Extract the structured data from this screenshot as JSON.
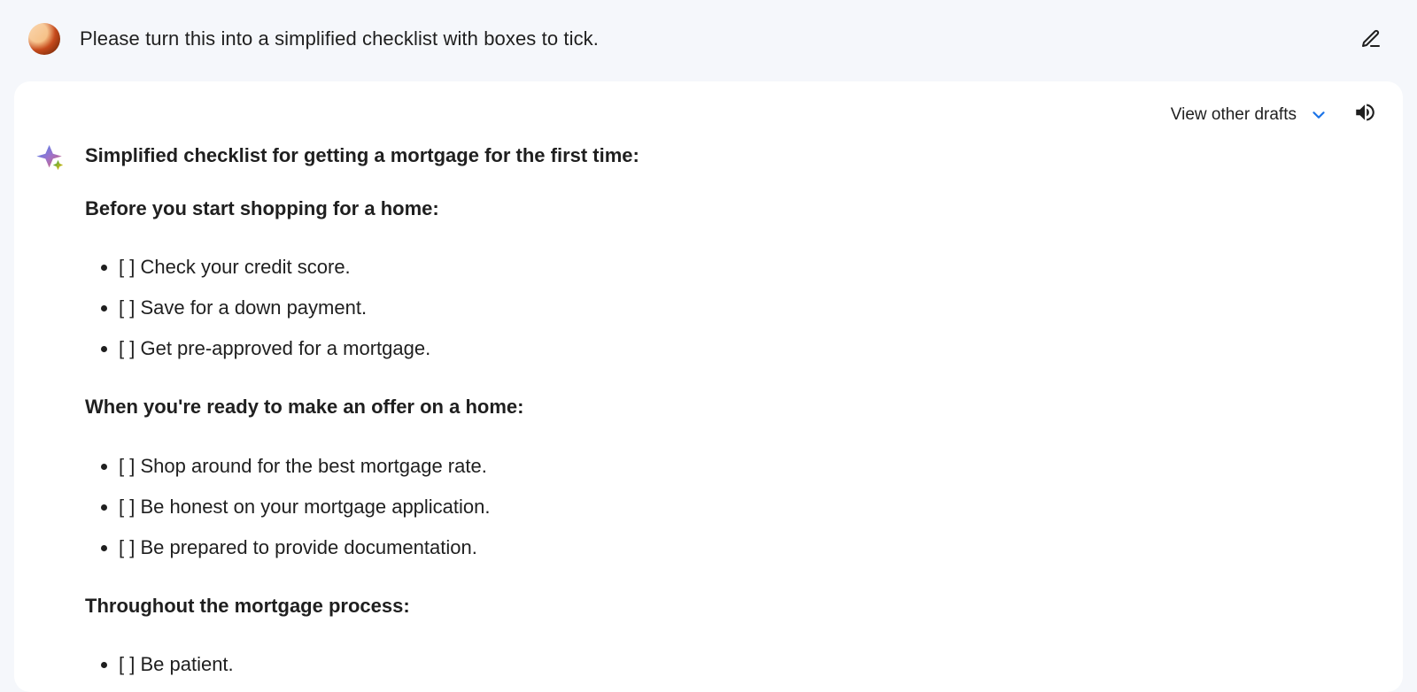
{
  "prompt": {
    "text": "Please turn this into a simplified checklist with boxes to tick."
  },
  "toolbar": {
    "view_drafts_label": "View other drafts"
  },
  "response": {
    "title": "Simplified checklist for getting a mortgage for the first time:",
    "checkbox_glyph": "[ ]",
    "sections": [
      {
        "heading": "Before you start shopping for a home:",
        "items": [
          "Check your credit score.",
          "Save for a down payment.",
          "Get pre-approved for a mortgage."
        ]
      },
      {
        "heading": "When you're ready to make an offer on a home:",
        "items": [
          "Shop around for the best mortgage rate.",
          "Be honest on your mortgage application.",
          "Be prepared to provide documentation."
        ]
      },
      {
        "heading": "Throughout the mortgage process:",
        "items": [
          "Be patient."
        ]
      }
    ]
  }
}
